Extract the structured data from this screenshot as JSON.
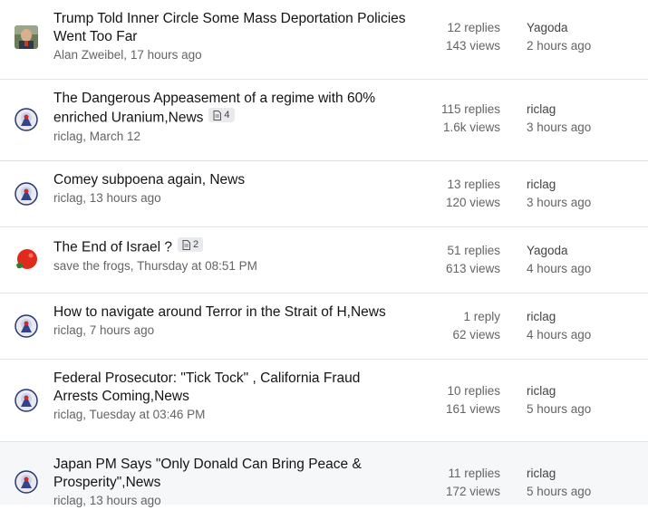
{
  "topics": [
    {
      "title": "Trump Told Inner Circle Some Mass Deportation Policies Went Too Far",
      "badge": null,
      "author": "Alan Zweibel",
      "posted": "17 hours ago",
      "replies": "12 replies",
      "views": "143 views",
      "last_user": "Yagoda",
      "last_time": "2 hours ago",
      "avatar": "photo-avatar"
    },
    {
      "title": "The Dangerous Appeasement of a regime with 60% enriched Uranium,News",
      "badge": "4",
      "author": "riclag",
      "posted": "March 12",
      "replies": "115 replies",
      "views": "1.6k views",
      "last_user": "riclag",
      "last_time": "3 hours ago",
      "avatar": "riclag-avatar"
    },
    {
      "title": "Comey subpoena again, News",
      "badge": null,
      "author": "riclag",
      "posted": "13 hours ago",
      "replies": "13 replies",
      "views": "120 views",
      "last_user": "riclag",
      "last_time": "3 hours ago",
      "avatar": "riclag-avatar"
    },
    {
      "title": "The End of Israel ?",
      "badge": "2",
      "author": "save the frogs",
      "posted": "Thursday at 08:51 PM",
      "replies": "51 replies",
      "views": "613 views",
      "last_user": "Yagoda",
      "last_time": "4 hours ago",
      "avatar": "red-avatar"
    },
    {
      "title": "How to navigate around Terror in the Strait of H,News",
      "badge": null,
      "author": "riclag",
      "posted": "7 hours ago",
      "replies": "1 reply",
      "views": "62 views",
      "last_user": "riclag",
      "last_time": "4 hours ago",
      "avatar": "riclag-avatar"
    },
    {
      "title": "Federal Prosecutor: \"Tick Tock\" , California Fraud Arrests Coming,News",
      "badge": null,
      "author": "riclag",
      "posted": "Tuesday at 03:46 PM",
      "replies": "10 replies",
      "views": "161 views",
      "last_user": "riclag",
      "last_time": "5 hours ago",
      "avatar": "riclag-avatar"
    },
    {
      "title": "Japan PM Says \"Only Donald Can Bring Peace & Prosperity\",News",
      "badge": null,
      "author": "riclag",
      "posted": "13 hours ago",
      "replies": "11 replies",
      "views": "172 views",
      "last_user": "riclag",
      "last_time": "5 hours ago",
      "avatar": "riclag-avatar"
    }
  ]
}
